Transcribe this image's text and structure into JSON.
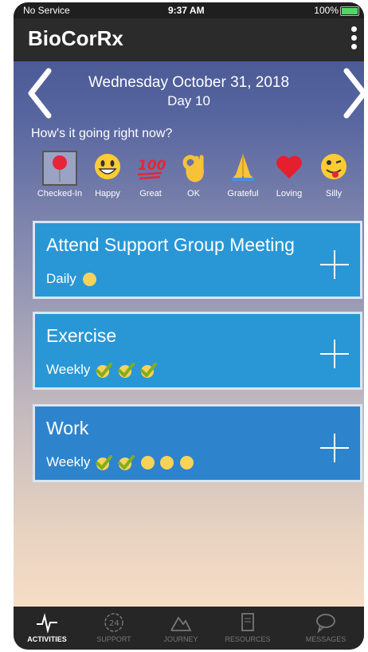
{
  "status": {
    "carrier": "No Service",
    "time": "9:37 AM",
    "battery": "100%"
  },
  "app": {
    "title": "BioCorRx"
  },
  "date": {
    "text": "Wednesday October 31, 2018",
    "day": "Day 10"
  },
  "prompt": "How's it going right now?",
  "moods": [
    {
      "label": "Checked-In",
      "icon": "pin-icon"
    },
    {
      "label": "Happy",
      "icon": "happy-face-icon"
    },
    {
      "label": "Great",
      "icon": "hundred-icon"
    },
    {
      "label": "OK",
      "icon": "ok-hand-icon"
    },
    {
      "label": "Grateful",
      "icon": "praying-hands-icon"
    },
    {
      "label": "Loving",
      "icon": "heart-icon"
    },
    {
      "label": "Silly",
      "icon": "silly-face-icon"
    }
  ],
  "activities": [
    {
      "name": "Attend Support Group Meeting",
      "frequency": "Daily",
      "marks": [
        "dot"
      ]
    },
    {
      "name": "Exercise",
      "frequency": "Weekly",
      "marks": [
        "check",
        "check",
        "check"
      ]
    },
    {
      "name": "Work",
      "frequency": "Weekly",
      "marks": [
        "check",
        "check",
        "dot",
        "dot",
        "dot"
      ]
    }
  ],
  "colors": {
    "card": "#2997d6",
    "dot": "#f7d35a",
    "check": "#a9d22f",
    "tabbar": "#262626"
  },
  "tabs": [
    {
      "label": "ACTIVITIES",
      "icon": "pulse-icon",
      "active": true
    },
    {
      "label": "SUPPORT",
      "icon": "support-24-icon",
      "active": false
    },
    {
      "label": "JOURNEY",
      "icon": "mountain-icon",
      "active": false
    },
    {
      "label": "RESOURCES",
      "icon": "book-icon",
      "active": false
    },
    {
      "label": "MESSAGES",
      "icon": "chat-bubble-icon",
      "active": false
    }
  ]
}
